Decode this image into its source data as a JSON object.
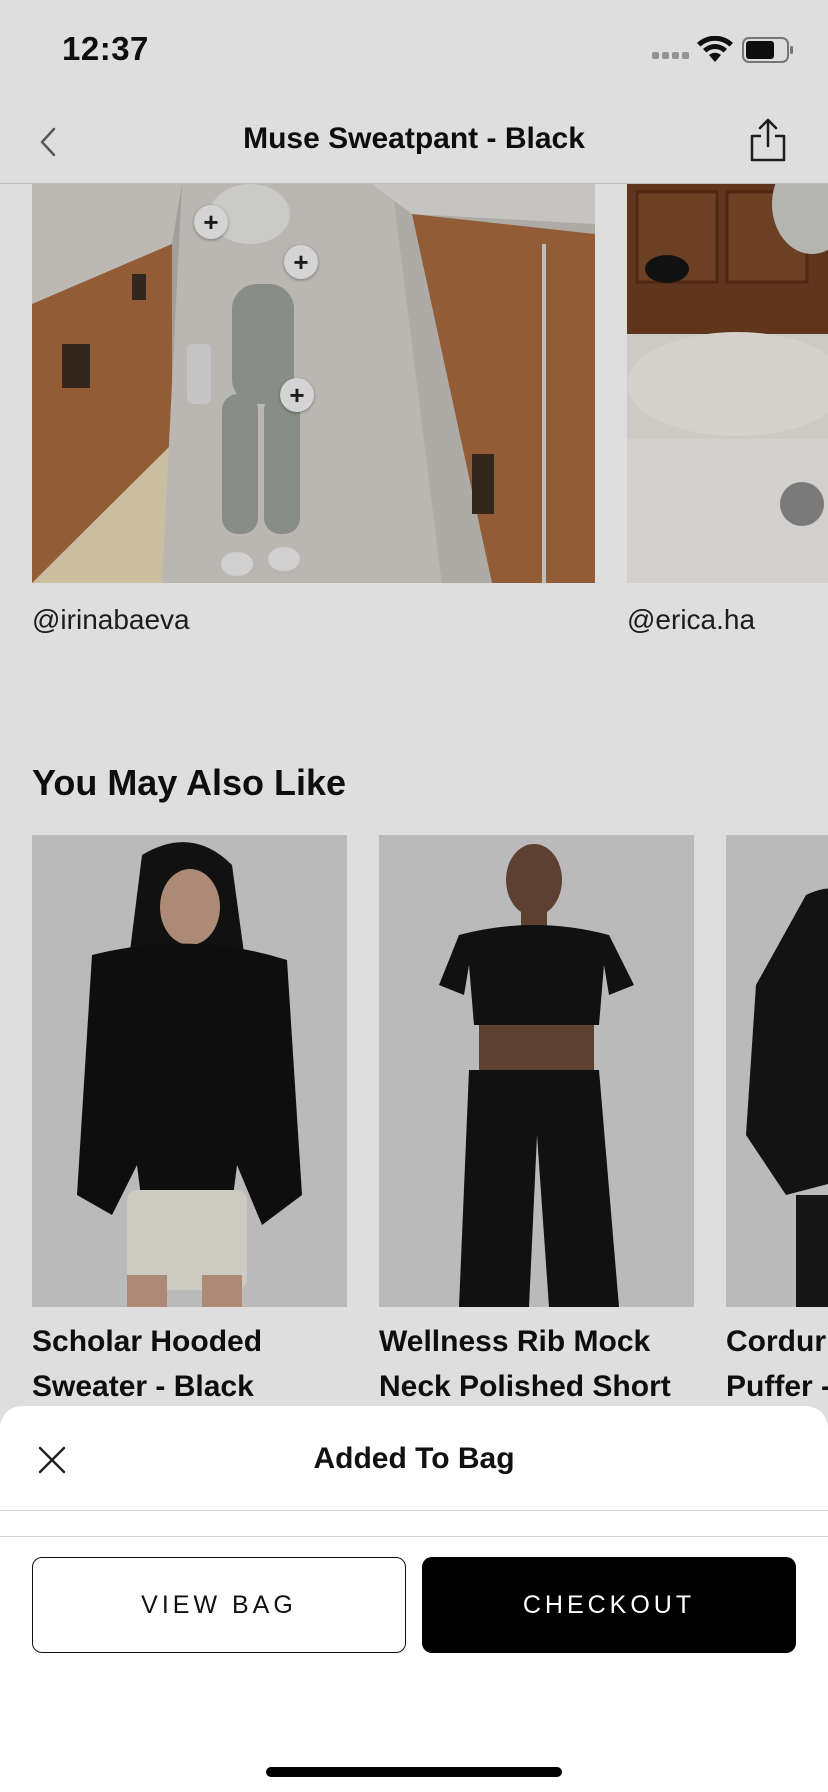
{
  "status_bar": {
    "time": "12:37",
    "icons": [
      "cellular-signal-icon",
      "wifi-icon",
      "battery-icon"
    ]
  },
  "header": {
    "title": "Muse Sweatpant - Black",
    "back_icon": "chevron-left-icon",
    "share_icon": "share-icon"
  },
  "ugc": {
    "items": [
      {
        "handle": "@irinabaeva",
        "hotspot_label": "+",
        "hotspot_count": 3
      },
      {
        "handle": "@erica.ha"
      }
    ]
  },
  "recommendations": {
    "heading": "You May Also Like",
    "products": [
      {
        "name": "Scholar Hooded\nSweater - Black"
      },
      {
        "name": "Wellness Rib Mock\nNeck Polished Short"
      },
      {
        "name": "Cordur\nPuffer -"
      }
    ]
  },
  "sheet": {
    "title": "Added To Bag",
    "close_icon": "close-icon",
    "view_bag_label": "VIEW BAG",
    "checkout_label": "CHECKOUT"
  },
  "colors": {
    "overlay": "#000000",
    "primary_button": "#000000",
    "background": "#ffffff"
  }
}
